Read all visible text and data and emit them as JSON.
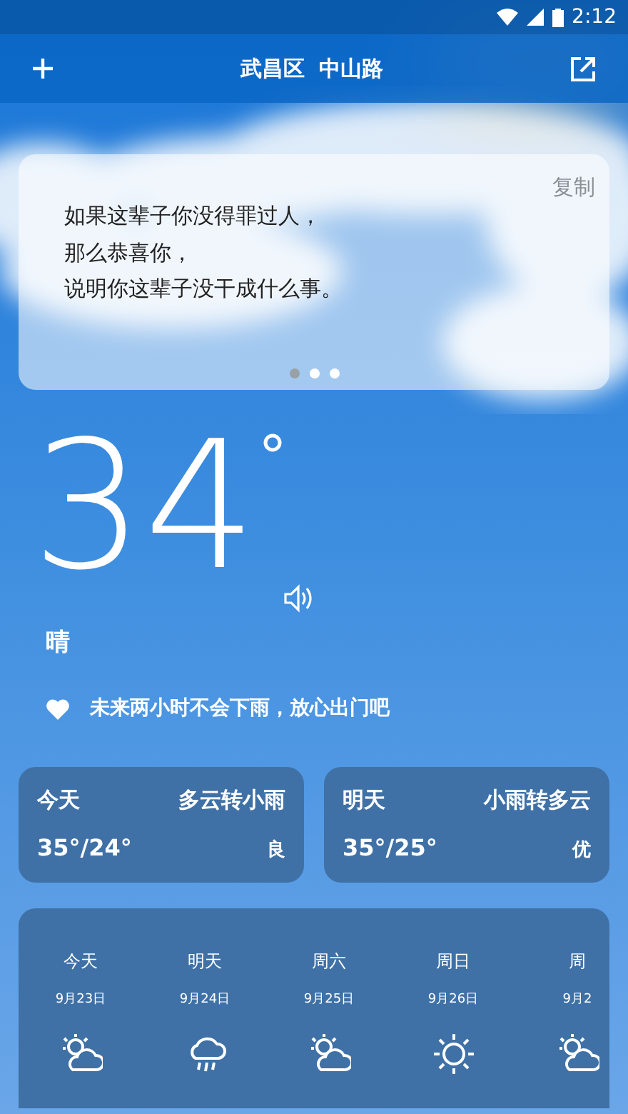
{
  "status_bar": {
    "time": "2:12"
  },
  "header": {
    "title": "武昌区  中山路"
  },
  "quote": {
    "copy_label": "复制",
    "lines": [
      "如果这辈子你没得罪过人，",
      "那么恭喜你，",
      "说明你这辈子没干成什么事。"
    ],
    "pages": [
      {
        "selected": true
      },
      {
        "selected": false
      },
      {
        "selected": false
      }
    ]
  },
  "current": {
    "temperature": "34",
    "condition": "晴",
    "tip": "未来两小时不会下雨，放心出门吧"
  },
  "days": [
    {
      "label": "今天",
      "forecast": "多云转小雨",
      "range": "35°/24°",
      "air": "良"
    },
    {
      "label": "明天",
      "forecast": "小雨转多云",
      "range": "35°/25°",
      "air": "优"
    }
  ],
  "forecast": [
    {
      "day": "今天",
      "date": "9月23日",
      "kind": "partly-cloudy"
    },
    {
      "day": "明天",
      "date": "9月24日",
      "kind": "rain"
    },
    {
      "day": "周六",
      "date": "9月25日",
      "kind": "partly-cloudy"
    },
    {
      "day": "周日",
      "date": "9月26日",
      "kind": "sunny"
    },
    {
      "day": "周",
      "date": "9月2",
      "kind": "partly-cloudy"
    }
  ]
}
